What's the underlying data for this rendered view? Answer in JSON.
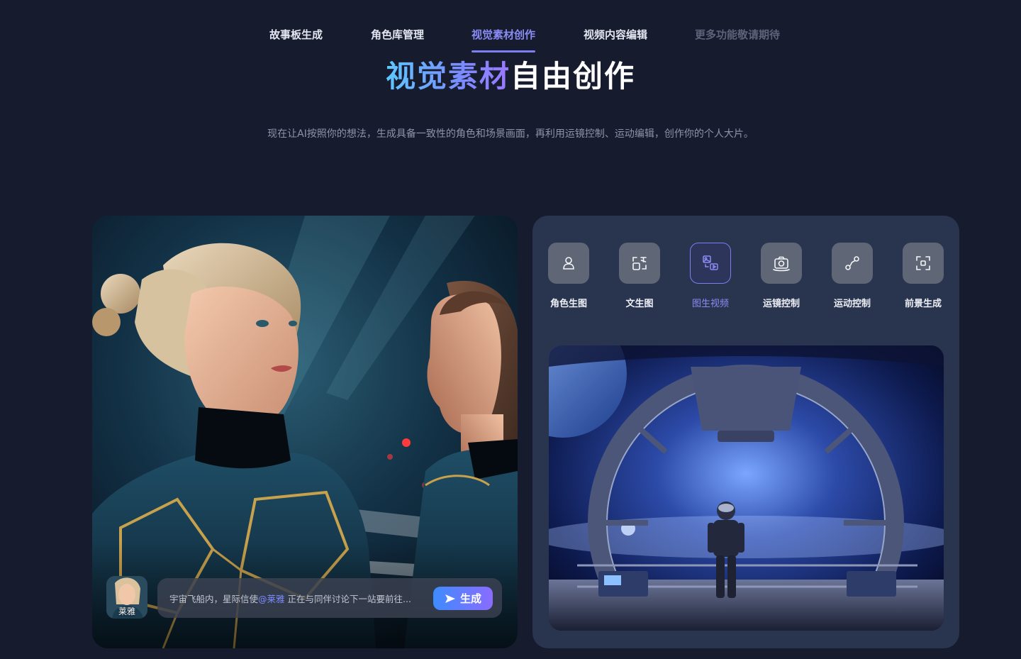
{
  "nav": {
    "tabs": [
      {
        "label": "故事板生成"
      },
      {
        "label": "角色库管理"
      },
      {
        "label": "视觉素材创作"
      },
      {
        "label": "视频内容编辑"
      },
      {
        "label": "更多功能敬请期待"
      }
    ],
    "active_index": 2
  },
  "hero": {
    "title_highlight": "视觉素材",
    "title_rest": "自由创作",
    "subtitle": "现在让AI按照你的想法，生成具备一致性的角色和场景画面，再利用运镜控制、运动编辑，创作你的个人大片。"
  },
  "left_card": {
    "avatar_name": "莱雅",
    "prompt_prefix": "宇宙飞船内，星际信使",
    "prompt_mention": "@莱雅",
    "prompt_suffix": " 正在与同伴讨论下一站要前往...",
    "generate_label": "生成"
  },
  "right_card": {
    "tools": [
      {
        "label": "角色生图",
        "icon": "person-icon"
      },
      {
        "label": "文生图",
        "icon": "text-to-image-icon"
      },
      {
        "label": "图生视频",
        "icon": "image-to-video-icon"
      },
      {
        "label": "运镜控制",
        "icon": "camera-icon"
      },
      {
        "label": "运动控制",
        "icon": "motion-path-icon"
      },
      {
        "label": "前景生成",
        "icon": "focus-frame-icon"
      }
    ],
    "active_tool_index": 2
  },
  "colors": {
    "background": "#161b2e",
    "accent": "#7d7ff0",
    "card_right": "#29344f"
  }
}
